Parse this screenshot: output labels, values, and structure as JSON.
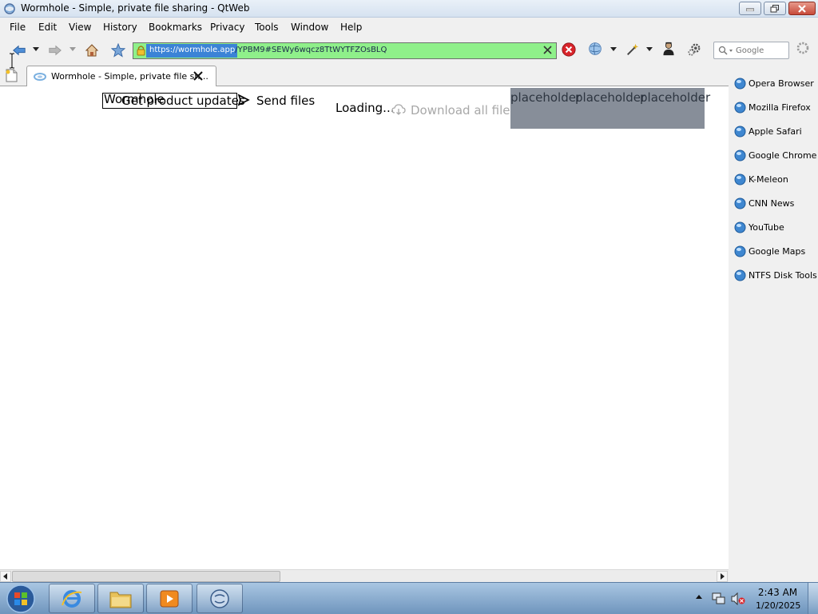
{
  "window": {
    "title": "Wormhole - Simple, private file sharing - QtWeb"
  },
  "menu": [
    "File",
    "Edit",
    "View",
    "History",
    "Bookmarks",
    "Privacy",
    "Tools",
    "Window",
    "Help"
  ],
  "toolbar": {
    "url_selected": "https://wormhole.app",
    "url_rest": "/YPBM9#SEWy6wqcz8TtWYTFZOsBLQ",
    "search_placeholder": "Google"
  },
  "tabs": [
    {
      "label": "Wormhole - Simple, private file sh..."
    }
  ],
  "page": {
    "logo_text": "Wormhole",
    "updates_link": "Get product updates",
    "send_files": "Send files",
    "loading": "Loading...",
    "download_all": "Download all files",
    "placeholders": [
      "placeholder",
      "placeholder",
      "placeholder"
    ]
  },
  "bookmarks": [
    "Opera Browser",
    "Mozilla Firefox",
    "Apple Safari",
    "Google Chrome",
    "K-Meleon",
    "CNN News",
    "YouTube",
    "Google Maps",
    "NTFS Disk Tools"
  ],
  "taskbar": {
    "time": "2:43 AM",
    "date": "1/20/2025"
  },
  "colors": {
    "url_bar_bg": "#8ff08a",
    "url_selection": "#3b83d6",
    "placeholder_bg": "#878e99"
  }
}
